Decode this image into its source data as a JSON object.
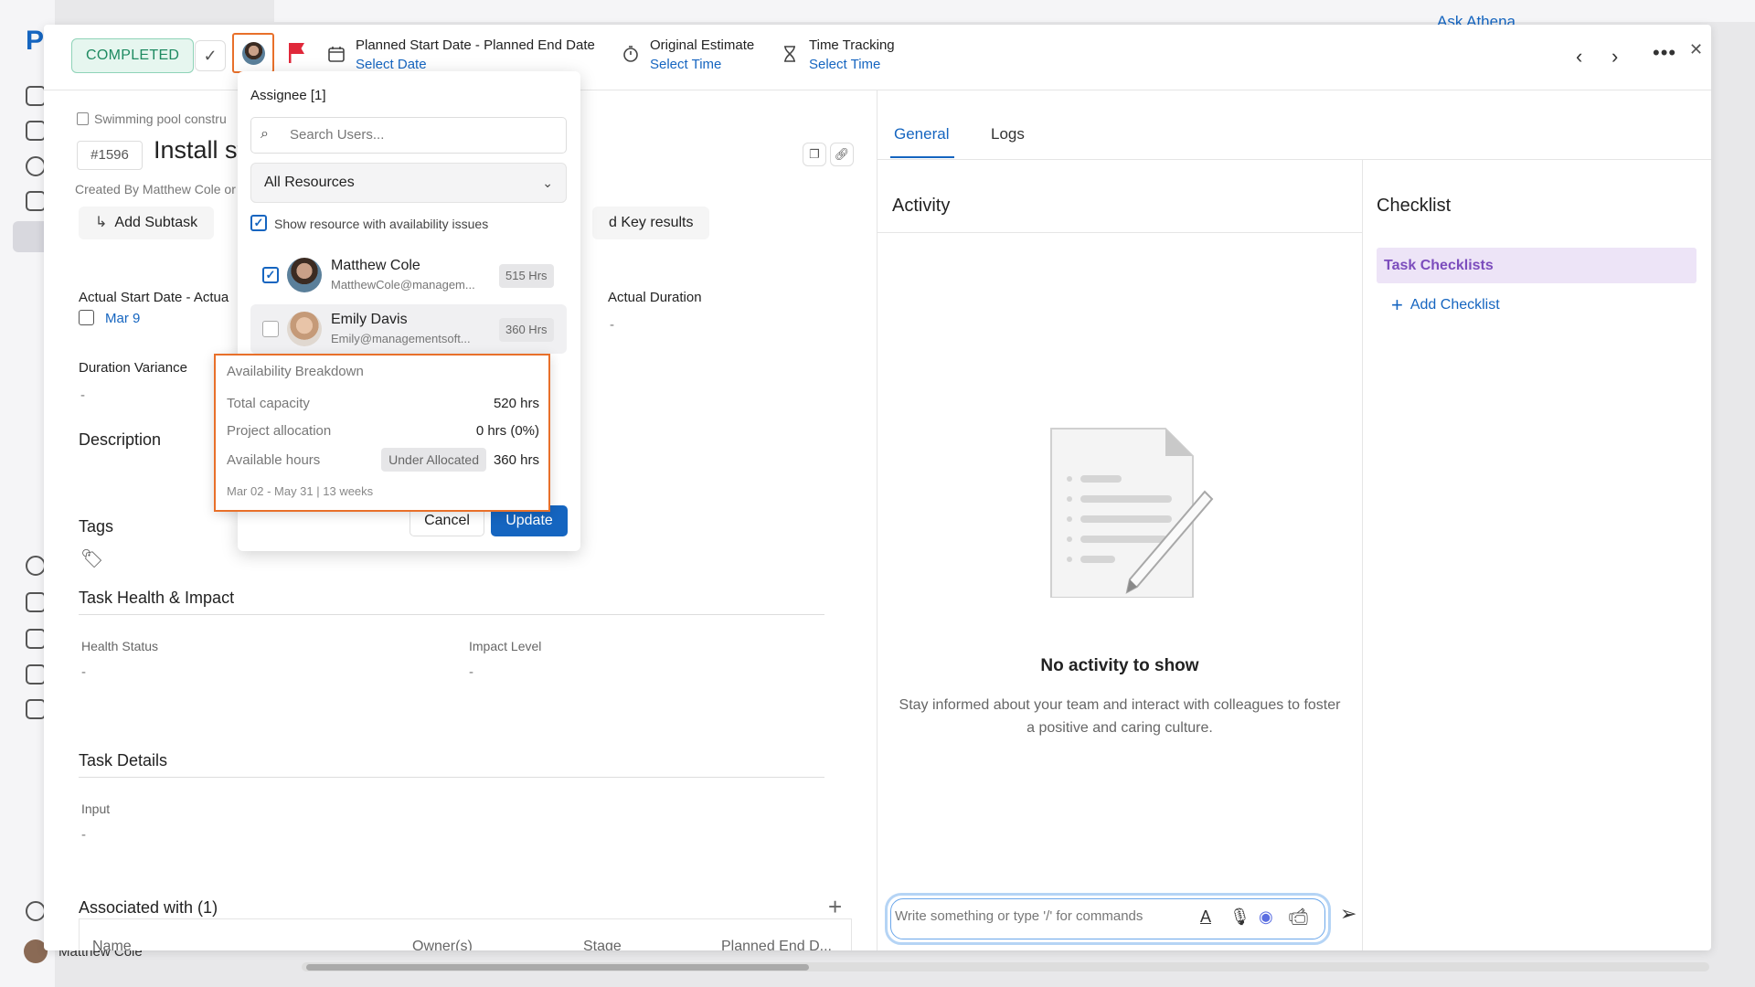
{
  "app": {
    "logo": "P",
    "ask_athena": "Ask Athena",
    "current_user": "Matthew Cole"
  },
  "toolbar": {
    "status": "COMPLETED",
    "check": "✓",
    "planned_dates": {
      "title": "Planned Start Date - Planned End Date",
      "value": "Select Date"
    },
    "original_estimate": {
      "title": "Original Estimate",
      "value": "Select Time"
    },
    "time_tracking": {
      "title": "Time Tracking",
      "value": "Select Time"
    },
    "flag_color": "#e0283a",
    "more": "•••",
    "close": "✕"
  },
  "task": {
    "breadcrumb": "Swimming pool constru",
    "id": "#1596",
    "title": "Install st",
    "created_by": "Created By Matthew Cole or",
    "add_subtask": "Add Subtask",
    "key_results": "d Key results",
    "actual_dates_label": "Actual Start Date - Actua",
    "actual_dates_value": "Mar 9",
    "actual_duration_label": "Actual Duration",
    "actual_duration_value": "-",
    "duration_variance_label": "Duration Variance",
    "duration_variance_value": "-",
    "description_label": "Description",
    "tags_label": "Tags",
    "health_section": "Task Health & Impact",
    "health_status_label": "Health Status",
    "health_status_value": "-",
    "impact_level_label": "Impact Level",
    "impact_level_value": "-",
    "details_section": "Task Details",
    "input_label": "Input",
    "input_value": "-",
    "associated_label": "Associated with (1)",
    "table_columns": [
      "Name",
      "Owner(s)",
      "Stage",
      "Planned End D..."
    ]
  },
  "right": {
    "tabs": [
      "General",
      "Logs"
    ],
    "activity_title": "Activity",
    "checklist_title": "Checklist",
    "task_checklists": "Task Checklists",
    "add_checklist": "Add Checklist",
    "empty_title": "No activity to show",
    "empty_text": "Stay informed about your team and interact with colleagues to foster a positive and caring culture.",
    "composer_placeholder": "Write something or type '/' for commands"
  },
  "assignee": {
    "title": "Assignee [1]",
    "search_placeholder": "Search Users...",
    "resource_filter": "All Resources",
    "availability_toggle": "Show resource with availability issues",
    "availability_toggle_checked": true,
    "users": [
      {
        "name": "Matthew Cole",
        "email": "MatthewCole@managem...",
        "hours": "515 Hrs",
        "checked": true
      },
      {
        "name": "Emily Davis",
        "email": "Emily@managementsoft...",
        "hours": "360 Hrs",
        "checked": false
      }
    ],
    "cancel": "Cancel",
    "update": "Update"
  },
  "availability": {
    "title": "Availability Breakdown",
    "total_capacity_label": "Total capacity",
    "total_capacity_value": "520 hrs",
    "project_allocation_label": "Project allocation",
    "project_allocation_value": "0 hrs (0%)",
    "available_hours_label": "Available hours",
    "available_hours_badge": "Under Allocated",
    "available_hours_value": "360 hrs",
    "period": "Mar 02 - May 31 | 13 weeks"
  }
}
